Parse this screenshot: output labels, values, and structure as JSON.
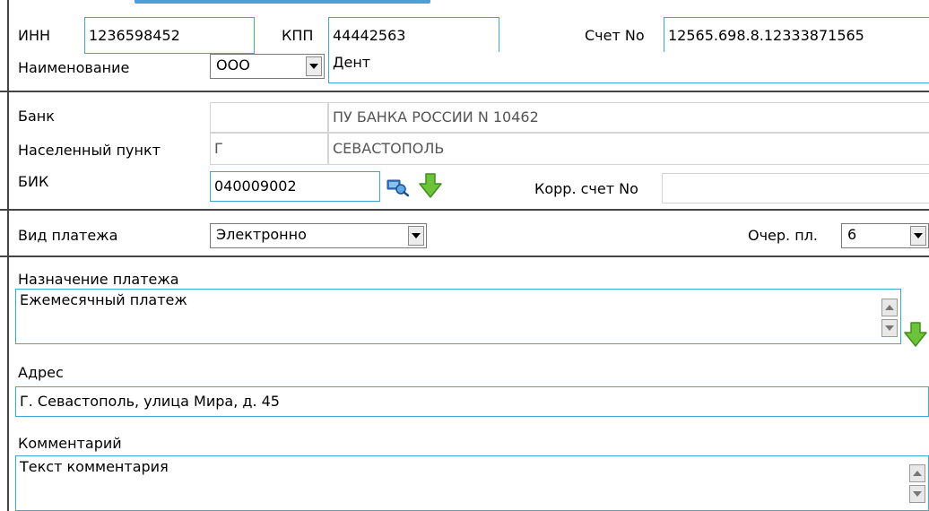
{
  "payer": {
    "inn_label": "ИНН",
    "inn_value": "1236598452",
    "kpp_label": "КПП",
    "kpp_value": "44442563",
    "account_label": "Счет No",
    "account_value": "12565.698.8.12333871565",
    "name_label": "Наименование",
    "org_form": "ООО",
    "name_value": "Дент"
  },
  "bank": {
    "bank_label": "Банк",
    "bank_value": "ПУ БАНКА РОССИИ N 10462",
    "city_label": "Населенный пункт",
    "city_type": "Г",
    "city_value": "СЕВАСТОПОЛЬ",
    "bik_label": "БИК",
    "bik_value": "040009002",
    "corr_label": "Корр. счет No",
    "corr_value": ""
  },
  "payment": {
    "type_label": "Вид платежа",
    "type_value": "Электронно",
    "priority_label": "Очер. пл.",
    "priority_value": "6"
  },
  "purpose": {
    "label": "Назначение платежа",
    "value": "Ежемесячный платеж"
  },
  "address": {
    "label": "Адрес",
    "value": "Г. Севастополь, улица Мира, д. 45"
  },
  "comment": {
    "label": "Комментарий",
    "value": "Текст комментария"
  },
  "colors": {
    "field_border": "#3fa6d6",
    "section_line": "#444444",
    "title_blue": "#2a8fd0",
    "green_arrow": "#6cc33a"
  },
  "icons": {
    "lookup": "bank-lookup-icon",
    "fill_down": "green-down-arrow-icon"
  }
}
